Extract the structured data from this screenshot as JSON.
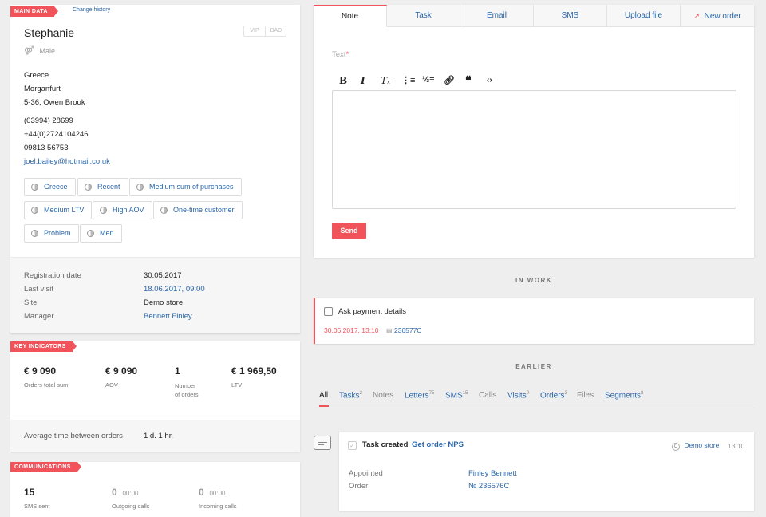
{
  "main": {
    "ribbon": "MAIN DATA",
    "change_history": "Change history",
    "name": "Stephanie",
    "vip": "VIP",
    "bad": "BAD",
    "gender": "Male",
    "address": [
      "Greece",
      "Morganfurt",
      "5-36, Owen Brook"
    ],
    "phones": [
      "(03994) 28699",
      "+44(0)2724104246",
      "09813 56753"
    ],
    "email": "joel.bailey@hotmail.co.uk",
    "tags": [
      "Greece",
      "Recent",
      "Medium sum of purchases",
      "Medium LTV",
      "High AOV",
      "One-time customer",
      "Problem",
      "Men"
    ],
    "details": [
      {
        "label": "Registration date",
        "value": "30.05.2017"
      },
      {
        "label": "Last visit",
        "value": "18.06.2017, 09:00"
      },
      {
        "label": "Site",
        "value": "Demo store"
      },
      {
        "label": "Manager",
        "value": "Bennett Finley"
      }
    ]
  },
  "key": {
    "ribbon": "KEY INDICATORS",
    "items": [
      {
        "value": "€ 9 090",
        "label": "Orders total sum"
      },
      {
        "value": "€ 9 090",
        "label": "AOV"
      },
      {
        "value": "1",
        "label": "Number of orders"
      },
      {
        "value": "€ 1 969,50",
        "label": "LTV"
      }
    ],
    "avg_label": "Average time between orders",
    "avg_value": "1 d. 1 hr."
  },
  "comm": {
    "ribbon": "COMMUNICATIONS",
    "items": [
      {
        "value": "15",
        "extra": "",
        "label": "SMS sent"
      },
      {
        "value": "0",
        "extra": "00:00",
        "label": "Outgoing calls"
      },
      {
        "value": "0",
        "extra": "00:00",
        "label": "Incoming calls"
      }
    ]
  },
  "tabs": [
    "Note",
    "Task",
    "Email",
    "SMS",
    "Upload file",
    "New order"
  ],
  "editor": {
    "label": "Text",
    "required": "*",
    "send": "Send"
  },
  "in_work": {
    "title": "IN WORK",
    "task": "Ask payment details",
    "date": "30.06.2017, 13:10",
    "order": "236577C"
  },
  "earlier": {
    "title": "EARLIER",
    "filters": [
      {
        "label": "All",
        "count": ""
      },
      {
        "label": "Tasks",
        "count": "2"
      },
      {
        "label": "Notes",
        "count": ""
      },
      {
        "label": "Letters",
        "count": "75"
      },
      {
        "label": "SMS",
        "count": "15"
      },
      {
        "label": "Calls",
        "count": ""
      },
      {
        "label": "Visits",
        "count": "9"
      },
      {
        "label": "Orders",
        "count": "3"
      },
      {
        "label": "Files",
        "count": ""
      },
      {
        "label": "Segments",
        "count": "8"
      }
    ],
    "event": {
      "prefix": "Task created",
      "link": "Get order NPS",
      "store": "Demo store",
      "time": "13:10",
      "rows": [
        {
          "label": "Appointed",
          "value": "Finley Bennett"
        },
        {
          "label": "Order",
          "value": "№ 236576C"
        }
      ]
    }
  },
  "colors": {
    "accent": "#f0535a",
    "link": "#2a66a8"
  }
}
